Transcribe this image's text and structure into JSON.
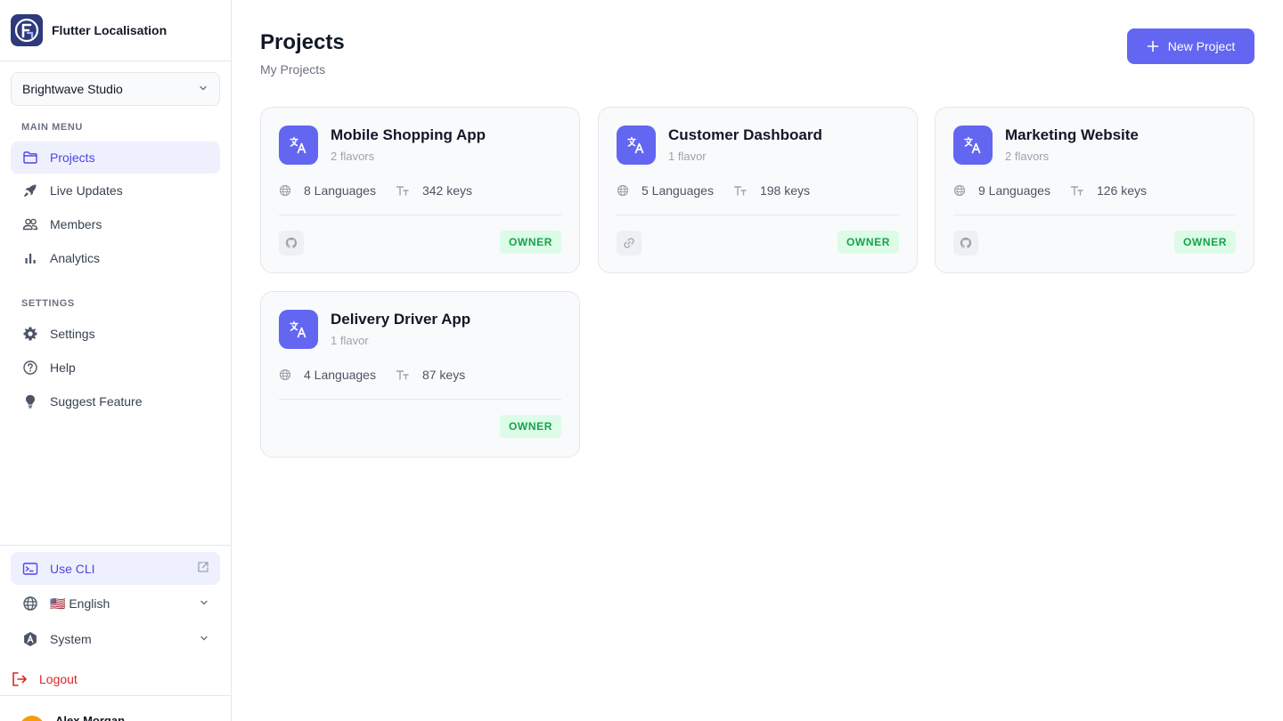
{
  "brand": {
    "title": "Flutter Localisation",
    "logo_icon": "flutter-logo"
  },
  "workspace": {
    "selected": "Brightwave Studio"
  },
  "sidebar": {
    "main_label": "MAIN MENU",
    "main_items": [
      {
        "label": "Projects",
        "icon": "folder-icon",
        "active": true
      },
      {
        "label": "Live Updates",
        "icon": "rocket-icon"
      },
      {
        "label": "Members",
        "icon": "users-icon"
      },
      {
        "label": "Analytics",
        "icon": "bar-chart-icon"
      }
    ],
    "settings_label": "SETTINGS",
    "settings_items": [
      {
        "label": "Settings",
        "icon": "gear-icon"
      },
      {
        "label": "Help",
        "icon": "help-icon"
      },
      {
        "label": "Suggest Feature",
        "icon": "lightbulb-icon"
      }
    ],
    "cli_label": "Use CLI",
    "language": "🇺🇸 English",
    "theme": "System",
    "logout": "Logout",
    "user_name": "Alex Morgan"
  },
  "header": {
    "title": "Projects",
    "subtitle": "My Projects",
    "new_project": "New Project"
  },
  "projects": [
    {
      "name": "Mobile Shopping App",
      "flavors": "2 flavors",
      "languages": "8 Languages",
      "keys": "342 keys",
      "link": "github-icon",
      "role": "OWNER"
    },
    {
      "name": "Customer Dashboard",
      "flavors": "1 flavor",
      "languages": "5 Languages",
      "keys": "198 keys",
      "link": "link-icon",
      "role": "OWNER"
    },
    {
      "name": "Marketing Website",
      "flavors": "2 flavors",
      "languages": "9 Languages",
      "keys": "126 keys",
      "link": "github-icon",
      "role": "OWNER"
    },
    {
      "name": "Delivery Driver App",
      "flavors": "1 flavor",
      "languages": "4 Languages",
      "keys": "87 keys",
      "link": "",
      "role": "OWNER"
    }
  ],
  "colors": {
    "accent": "#6366f1",
    "accent_soft": "#eef0fd",
    "owner_bg": "#dcfce7",
    "owner_text": "#16a34a",
    "logout": "#dc2626"
  }
}
